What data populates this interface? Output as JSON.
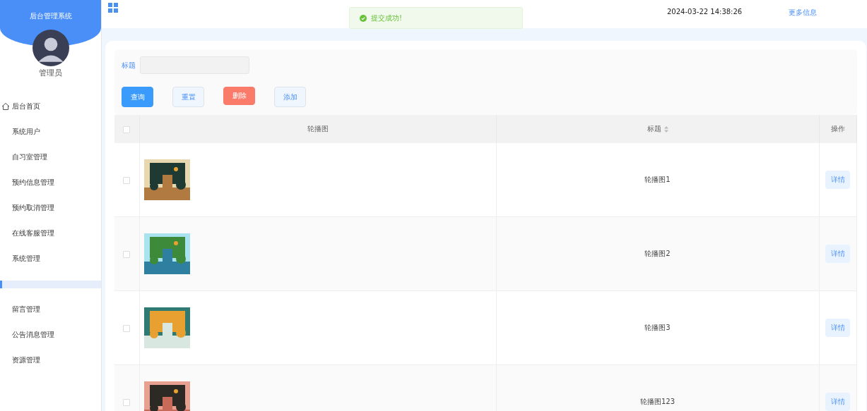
{
  "sidebar": {
    "title": "后台管理系统",
    "user": "管理员",
    "items": [
      {
        "kind": "home",
        "label": "后台首页",
        "selected": false
      },
      {
        "kind": "link",
        "label": "系统用户",
        "selected": false
      },
      {
        "kind": "link",
        "label": "自习室管理",
        "selected": false
      },
      {
        "kind": "link",
        "label": "预约信息管理",
        "selected": false
      },
      {
        "kind": "link",
        "label": "预约取消管理",
        "selected": false
      },
      {
        "kind": "link",
        "label": "在线客服管理",
        "selected": false
      },
      {
        "kind": "link",
        "label": "系统管理",
        "selected": false
      },
      {
        "kind": "blank",
        "selected": true
      },
      {
        "kind": "link",
        "label": "留言管理",
        "selected": false
      },
      {
        "kind": "link",
        "label": "公告消息管理",
        "selected": false
      },
      {
        "kind": "link",
        "label": "资源管理",
        "selected": false
      }
    ]
  },
  "topbar": {
    "datetime": "2024-03-22 14:38:26",
    "more": "更多信息"
  },
  "toast": {
    "message": "提交成功!"
  },
  "search": {
    "label": "标题"
  },
  "buttons": [
    {
      "kind": "primary",
      "label": "查询"
    },
    {
      "kind": "plain",
      "label": "重置"
    },
    {
      "kind": "danger",
      "label": "删除"
    },
    {
      "kind": "plain",
      "label": "添加"
    }
  ],
  "table": {
    "columns": [
      "轮播图",
      "标题",
      "操作"
    ],
    "all_checked": false,
    "rows": [
      {
        "checked": false,
        "title": "轮播图1",
        "action": "详情"
      },
      {
        "checked": false,
        "title": "轮播图2",
        "action": "详情"
      },
      {
        "checked": false,
        "title": "轮播图3",
        "action": "详情"
      },
      {
        "checked": false,
        "title": "轮播图123",
        "action": "详情"
      }
    ]
  }
}
